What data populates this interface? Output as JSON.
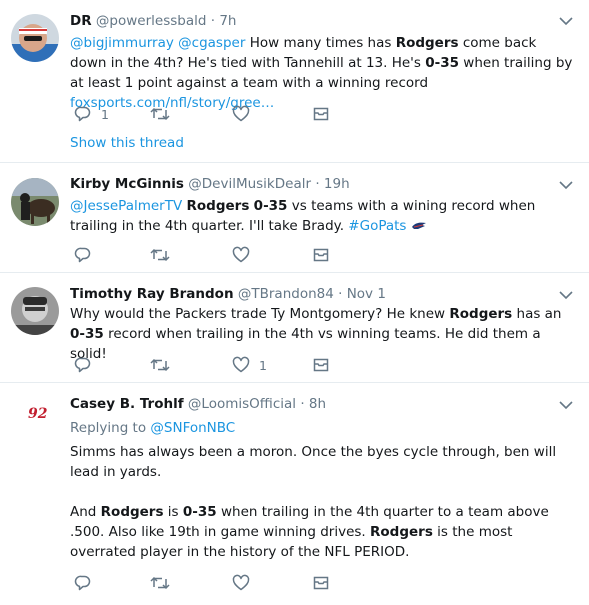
{
  "tweets": [
    {
      "name": "DR",
      "handle": "@powerlessbald",
      "dot": "·",
      "time": "7h",
      "text_parts": {
        "m1": "@bigjimmurray",
        "m2": "@cgasper",
        "t1": " How many times has ",
        "b1": "Rodgers",
        "t2": " come back down in the 4th? He's tied with Tannehill at 13. He's ",
        "b2": "0-35",
        "t3": " when trailing by at least 1 point against a team with a winning record ",
        "url": "foxsports.com/nfl/story/gree…"
      },
      "reply_count": "1",
      "retweet_count": "",
      "like_count": "",
      "show_thread": "Show this thread"
    },
    {
      "name": "Kirby McGinnis",
      "handle": "@DevilMusikDealr",
      "dot": "·",
      "time": "19h",
      "text_parts": {
        "m1": "@JessePalmerTV",
        "b1": "Rodgers",
        "b2": "0-35",
        "t1": " vs teams with a wining record when trailing in the 4th quarter. I'll take Brady. ",
        "tag": "#GoPats"
      },
      "reply_count": "",
      "retweet_count": "",
      "like_count": ""
    },
    {
      "name": "Timothy Ray Brandon",
      "handle": "@TBrandon84",
      "dot": "·",
      "time": "Nov 1",
      "text_parts": {
        "t1": "Why would the Packers trade Ty Montgomery? He knew ",
        "b1": "Rodgers",
        "t2": " has an ",
        "b2": "0-35",
        "t3": " record when trailing in the 4th vs winning teams. He did them a solid!"
      },
      "reply_count": "",
      "retweet_count": "",
      "like_count": "1"
    },
    {
      "name": "Casey B. Trohlf",
      "handle": "@LoomisOfficial",
      "dot": "·",
      "time": "8h",
      "replying_label": "Replying to",
      "replying_to": "@SNFonNBC",
      "para1": "Simms has always been a moron. Once the byes cycle through, ben will lead in yards.",
      "text_parts": {
        "t1": "And ",
        "b1": "Rodgers",
        "t2": " is ",
        "b2": "0-35",
        "t3": " when trailing in the 4th quarter to a team above .500. Also like 19th in game winning drives. ",
        "b3": "Rodgers",
        "t4": " is the most overrated player in the history of the NFL PERIOD."
      },
      "reply_count": "",
      "retweet_count": "",
      "like_count": ""
    }
  ],
  "icons": {
    "reply": "reply-icon",
    "retweet": "retweet-icon",
    "like": "heart-icon",
    "dm": "envelope-icon",
    "caret": "chevron-down-icon"
  },
  "colors": {
    "link": "#1b95e0",
    "secondary": "#657786",
    "divider": "#e6ecf0",
    "text": "#14171a"
  }
}
